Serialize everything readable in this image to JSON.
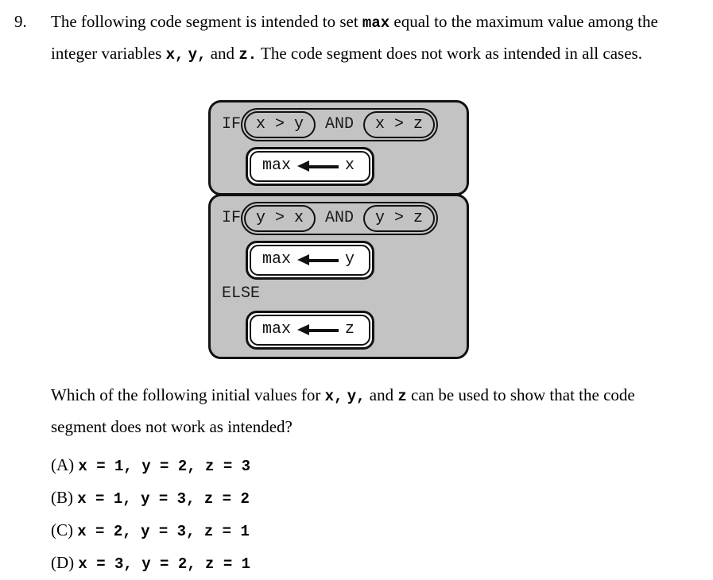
{
  "question": {
    "number": "9.",
    "stem_part1": "The following code segment is intended to set ",
    "stem_mono1": "max",
    "stem_part2": " equal to the maximum value among the integer variables ",
    "stem_mono2": "x,",
    "stem_mono3": "y,",
    "stem_part3": " and ",
    "stem_mono4": "z.",
    "stem_part4": " The code segment does not work as intended in all cases."
  },
  "code_diagram": {
    "blocks": [
      {
        "keyword": "IF",
        "condition_left": "x > y",
        "operator": "AND",
        "condition_right": "x > z",
        "statement_target": "max",
        "statement_source": "x",
        "else_keyword": null,
        "else_statement_target": null,
        "else_statement_source": null
      },
      {
        "keyword": "IF",
        "condition_left": "y > x",
        "operator": "AND",
        "condition_right": "y > z",
        "statement_target": "max",
        "statement_source": "y",
        "else_keyword": "ELSE",
        "else_statement_target": "max",
        "else_statement_source": "z"
      }
    ],
    "block_fill_color": "#c3c3c3",
    "border_color": "#111111",
    "statement_fill_color": "#ffffff"
  },
  "tail": {
    "line1": "Which of the following initial values for ",
    "mono_x": "x,",
    "mono_y": "y,",
    "and_word": " and ",
    "mono_z": "z",
    "line1_end": " can be used to show",
    "line2": "that the code segment does not work as intended?"
  },
  "choices": [
    {
      "letter": "(A)",
      "values": "x = 1, y = 2, z = 3"
    },
    {
      "letter": "(B)",
      "values": "x = 1, y = 3, z = 2"
    },
    {
      "letter": "(C)",
      "values": "x = 2, y = 3, z = 1"
    },
    {
      "letter": "(D)",
      "values": "x = 3, y = 2, z = 1"
    }
  ]
}
